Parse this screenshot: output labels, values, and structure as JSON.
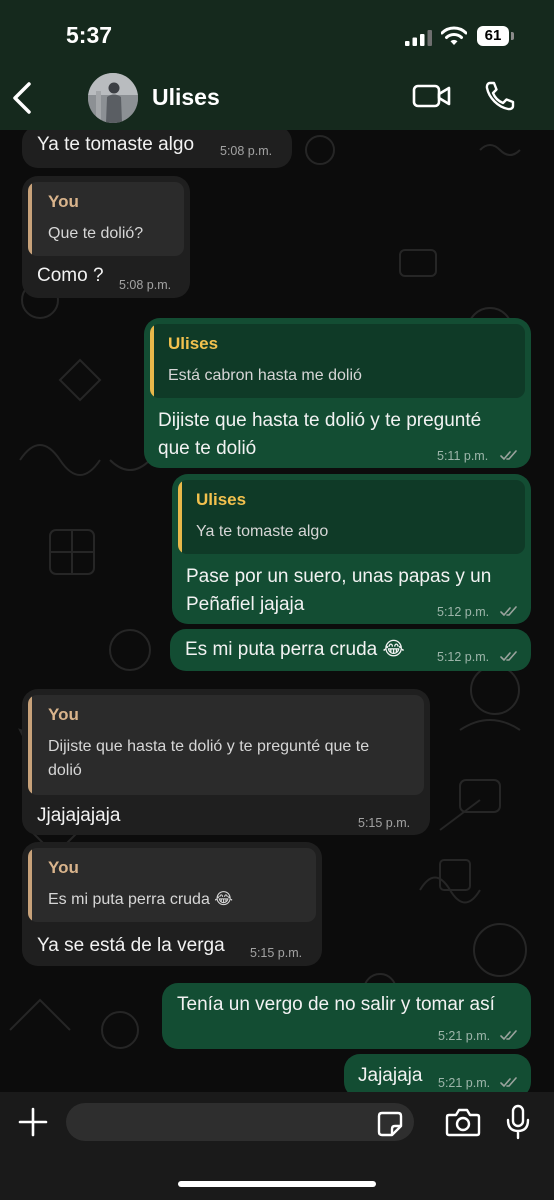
{
  "status_bar": {
    "time": "5:37",
    "battery": "61"
  },
  "header": {
    "contact_name": "Ulises"
  },
  "messages": [
    {
      "dir": "in",
      "text": "Ya te tomaste algo",
      "time": "5:08 p.m."
    },
    {
      "dir": "in",
      "quote_author": "You",
      "quote_text": "Que te dolió?",
      "text": "Como ?",
      "time": "5:08 p.m."
    },
    {
      "dir": "out",
      "quote_author": "Ulises",
      "quote_text": "Está cabron hasta me dolió",
      "text_lines": [
        "Dijiste que hasta te dolió y te pregunté",
        "que te dolió"
      ],
      "time": "5:11 p.m."
    },
    {
      "dir": "out",
      "quote_author": "Ulises",
      "quote_text": "Ya te tomaste algo",
      "text_lines": [
        "Pase por un suero, unas papas y un",
        "Peñafiel jajaja"
      ],
      "time": "5:12 p.m."
    },
    {
      "dir": "out",
      "text": "Es mi puta perra cruda 😂",
      "time": "5:12 p.m."
    },
    {
      "dir": "in",
      "quote_author": "You",
      "quote_lines": [
        "Dijiste que hasta te dolió y te pregunté que te",
        "dolió"
      ],
      "text": "Jjajajajaja",
      "time": "5:15 p.m."
    },
    {
      "dir": "in",
      "quote_author": "You",
      "quote_text": "Es mi puta perra cruda 😂",
      "text": "Ya se está de la verga",
      "time": "5:15 p.m."
    },
    {
      "dir": "out",
      "text": "Tenía un vergo de no salir y tomar así",
      "time": "5:21 p.m."
    },
    {
      "dir": "out",
      "text": "Jajajaja",
      "time": "5:21 p.m."
    }
  ],
  "input": {
    "placeholder": ""
  },
  "colors": {
    "header_bg": "#15291d",
    "incoming_bubble": "#1f1f1f",
    "outgoing_bubble": "#134d33",
    "you_accent": "#d9b48c",
    "contact_accent": "#f2c14e",
    "read_ticks": "#9aa39d"
  },
  "icons": [
    "back-chevron-icon",
    "video-camera-icon",
    "phone-icon",
    "plus-icon",
    "sticker-icon",
    "camera-icon",
    "microphone-icon",
    "double-check-icon"
  ]
}
